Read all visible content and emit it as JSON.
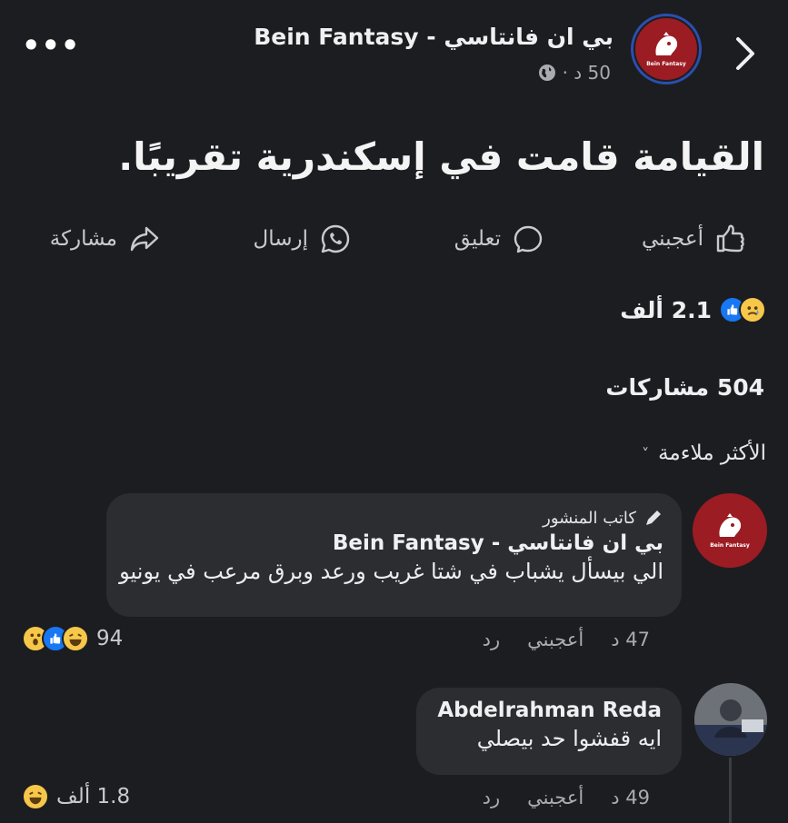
{
  "header": {
    "page_name": "بي ان فانتاسي - Bein Fantasy",
    "avatar_text": "Bein Fantasy",
    "time": "50 د ·",
    "more_label": "•••"
  },
  "post": {
    "text": "القيامة قامت في إسكندرية تقريبًا."
  },
  "actions": {
    "like": "أعجبني",
    "comment": "تعليق",
    "send": "إرسال",
    "share": "مشاركة"
  },
  "stats": {
    "reactions_count": "2.1 ألف",
    "shares": "504 مشاركات"
  },
  "sort": {
    "label": "الأكثر ملاءمة",
    "chevron": "˅"
  },
  "comments": [
    {
      "author_tag": "كاتب المنشور",
      "name": "بي ان فانتاسي - Bein Fantasy",
      "text": "الي بيسأل يشباب في شتا غريب ورعد وبرق مرعب في يونيو",
      "time": "47 د",
      "like": "أعجبني",
      "reply": "رد",
      "reaction_count": "94"
    },
    {
      "name": "Abdelrahman Reda",
      "text": "ايه قفشوا حد بيصلي",
      "time": "49 د",
      "like": "أعجبني",
      "reply": "رد",
      "reaction_count": "1.8 ألف"
    }
  ],
  "colors": {
    "background": "#1c1d20",
    "bubble": "#2c2d31",
    "brand_red": "#9b1c22",
    "like_blue": "#1877f2",
    "emoji_yellow": "#f7c74a"
  }
}
